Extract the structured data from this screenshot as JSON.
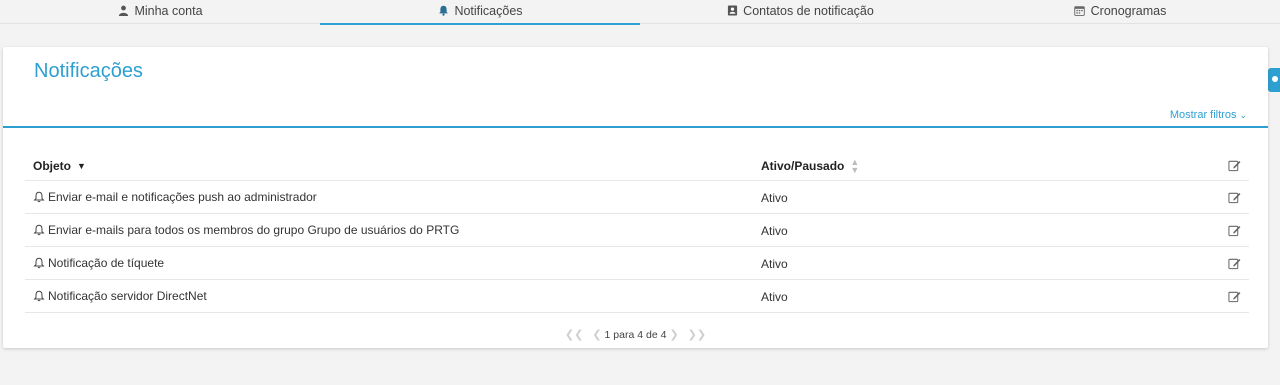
{
  "tabs": [
    {
      "label": "Minha conta",
      "icon": "user-icon",
      "active": false
    },
    {
      "label": "Notificações",
      "icon": "bell-icon",
      "active": true
    },
    {
      "label": "Contatos de notificação",
      "icon": "contact-card-icon",
      "active": false
    },
    {
      "label": "Cronogramas",
      "icon": "calendar-icon",
      "active": false
    }
  ],
  "page": {
    "title": "Notificações",
    "filter_link": "Mostrar filtros"
  },
  "table": {
    "headers": {
      "object": "Objeto",
      "status": "Ativo/Pausado"
    },
    "rows": [
      {
        "object": "Enviar e-mail e notificações push ao administrador",
        "status": "Ativo"
      },
      {
        "object": "Enviar e-mails para todos os membros do grupo Grupo de usuários do PRTG",
        "status": "Ativo"
      },
      {
        "object": "Notificação de tíquete",
        "status": "Ativo"
      },
      {
        "object": "Notificação servidor DirectNet",
        "status": "Ativo"
      }
    ]
  },
  "pager": {
    "label": "1 para 4 de 4"
  },
  "colors": {
    "accent": "#2e9fd1",
    "background": "#f3f3f3"
  }
}
